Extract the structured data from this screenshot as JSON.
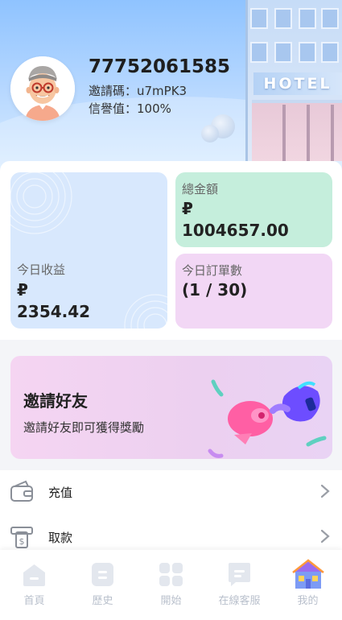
{
  "user": {
    "id": "77752061585",
    "invite_code_line": "邀請碼：u7mPK3",
    "credit_line": "信譽值：100%"
  },
  "header": {
    "building_sign": "HOTEL"
  },
  "stats": {
    "today_income": {
      "label": "今日收益",
      "currency": "₽",
      "amount": "2354.42"
    },
    "total_amount": {
      "label": "總金額",
      "currency": "₽",
      "amount": "1004657.00"
    },
    "today_orders": {
      "label": "今日訂單數",
      "value": "(1 / 30)"
    }
  },
  "invite": {
    "title": "邀請好友",
    "subtitle": "邀請好友即可獲得獎勵"
  },
  "menu": {
    "items": [
      {
        "label": "充值",
        "icon": "wallet-icon"
      },
      {
        "label": "取款",
        "icon": "withdraw-icon"
      }
    ]
  },
  "tabbar": {
    "tabs": [
      {
        "label": "首頁",
        "icon": "home-icon"
      },
      {
        "label": "歷史",
        "icon": "history-icon"
      },
      {
        "label": "開始",
        "icon": "start-grid-icon"
      },
      {
        "label": "在線客服",
        "icon": "chat-support-icon"
      },
      {
        "label": "我的",
        "icon": "my-house-icon",
        "active": true
      }
    ]
  },
  "colors": {
    "header_top": "#8fc3ff",
    "card_today": "#d8e8fd",
    "card_total": "#c5eedc",
    "card_orders": "#f2d7f5",
    "invite_bg": "#f5d5f2",
    "tab_inactive": "#b9c0cc"
  }
}
